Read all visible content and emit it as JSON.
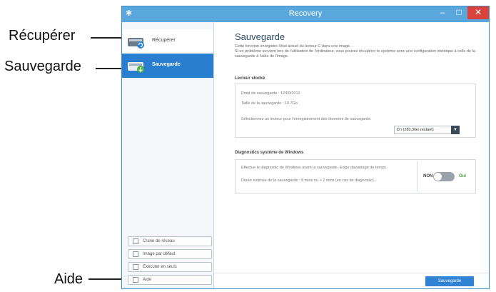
{
  "callouts": {
    "recuperer": "Récupérer",
    "sauvegarde": "Sauvegarde",
    "aide": "Aide"
  },
  "window": {
    "title": "Recovery",
    "minimize_glyph": "–",
    "maximize_glyph": "□",
    "close_glyph": "✕",
    "accent_color": "#2a7ecf"
  },
  "sidebar": {
    "items": [
      {
        "label": "Récupérer",
        "icon": "disk-restore-icon",
        "active": false
      },
      {
        "label": "Sauvegarde",
        "icon": "disk-backup-icon",
        "active": true
      }
    ],
    "buttons": [
      {
        "label": "Crane de réseau",
        "icon": "network-icon"
      },
      {
        "label": "Image par défaut",
        "icon": "image-icon"
      },
      {
        "label": "Exécuter en seuls",
        "icon": "run-icon"
      },
      {
        "label": "Aide",
        "icon": "help-icon"
      }
    ]
  },
  "main": {
    "title": "Sauvegarde",
    "description_line1": "Cette fonction enregistre l'état actuel du lecteur C dans une image.",
    "description_line2": "Si un problème survient lors de l'utilisation de l'ordinateur, vous pouvez récupérer le système avec une configuration identique à celle de la sauvegarde à l'aide de l'image.",
    "section1": {
      "title": "Lecteur stocké",
      "point_label": "Point de sauvegarde : 12/09/2012",
      "size_label": "Taille de la sauvegarde : 10.7Go",
      "select_prompt": "Sélectionnez un lecteur pour l'enregistrement des données de sauvegarde.",
      "select_value": "D:\\ (283,3Go restant)"
    },
    "section2": {
      "title": "Diagnostics système de Windows",
      "text_line1": "Effectue le diagnostic de Windows avant la sauvegarde. Exige davantage de temps.",
      "text_line2": "Durée estimée de la sauvegarde : 8 mins ou + 2 mins (en cas de diagnostic)",
      "toggle_off": "NON",
      "toggle_on": "Oui",
      "toggle_state": "off"
    },
    "primary_button": "Sauvegarde"
  }
}
